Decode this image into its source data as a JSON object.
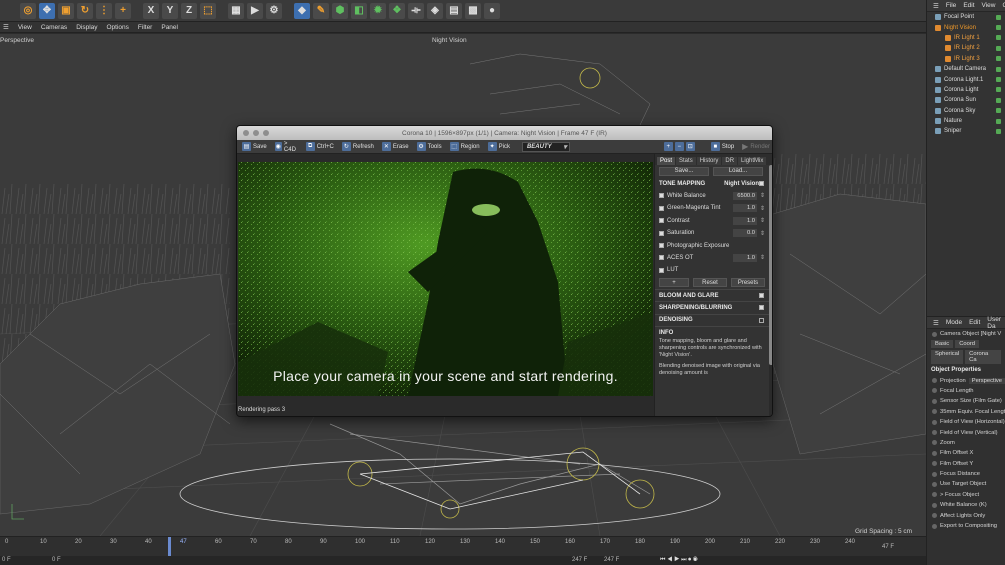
{
  "top_menu": [
    "View",
    "Cameras",
    "Display",
    "Options",
    "Filter",
    "Panel"
  ],
  "toolbar_axes": [
    "X",
    "Y",
    "Z"
  ],
  "viewport": {
    "label": "Perspective",
    "camera_label": "Night Vision",
    "grid_spacing": "Grid Spacing : 5 cm",
    "frame": "47 F"
  },
  "timeline": {
    "ticks": [
      "0",
      "10",
      "20",
      "30",
      "40",
      "47",
      "60",
      "70",
      "80",
      "90",
      "100",
      "110",
      "120",
      "130",
      "140",
      "150",
      "160",
      "170",
      "180",
      "190",
      "200",
      "210",
      "220",
      "230",
      "240"
    ],
    "current_frame": "47",
    "start": "0 F",
    "start2": "0 F",
    "end": "247 F",
    "end2": "247 F"
  },
  "objects_panel": {
    "menu": [
      "File",
      "Edit",
      "View",
      "Ob"
    ],
    "items": [
      {
        "label": "Focal Point",
        "type": "normal"
      },
      {
        "label": "Night Vision",
        "type": "orange"
      },
      {
        "label": "IR Light 1",
        "type": "light"
      },
      {
        "label": "IR Light 2",
        "type": "light"
      },
      {
        "label": "IR Light 3",
        "type": "light"
      },
      {
        "label": "Default Camera",
        "type": "normal"
      },
      {
        "label": "Corona Light.1",
        "type": "normal"
      },
      {
        "label": "Corona Light",
        "type": "normal"
      },
      {
        "label": "Corona Sun",
        "type": "normal"
      },
      {
        "label": "Corona Sky",
        "type": "normal"
      },
      {
        "label": "Nature",
        "type": "normal"
      },
      {
        "label": "Sniper",
        "type": "normal"
      }
    ]
  },
  "attributes_panel": {
    "menu": [
      "Mode",
      "Edit",
      "User Da"
    ],
    "object_label": "Camera Object [Night V",
    "tabs": [
      "Basic",
      "Coord",
      "Spherical",
      "Corona Ca"
    ],
    "section": "Object Properties",
    "rows": [
      {
        "label": "Projection",
        "value": "Perspective"
      },
      {
        "label": "Focal Length",
        "value": ""
      },
      {
        "label": "Sensor Size (Film Gate)",
        "value": ""
      },
      {
        "label": "35mm Equiv. Focal Length",
        "value": ""
      },
      {
        "label": "Field of View (Horizontal)",
        "value": ""
      },
      {
        "label": "Field of View (Vertical)",
        "value": ""
      },
      {
        "label": "Zoom",
        "value": ""
      },
      {
        "label": "Film Offset X",
        "value": ""
      },
      {
        "label": "Film Offset Y",
        "value": ""
      },
      {
        "label": "Focus Distance",
        "value": ""
      },
      {
        "label": "Use Target Object",
        "value": ""
      },
      {
        "label": "> Focus Object",
        "value": ""
      },
      {
        "label": "White Balance (K)",
        "value": ""
      },
      {
        "label": "Affect Lights Only",
        "value": ""
      },
      {
        "label": "Export to Compositing",
        "value": ""
      }
    ]
  },
  "corona": {
    "title": "Corona 10 | 1596×897px (1/1) | Camera: Night Vision | Frame 47 F (IR)",
    "toolbar": [
      "Save",
      "> C4D",
      "Ctrl+C",
      "Refresh",
      "Erase",
      "Tools",
      "Region",
      "Pick"
    ],
    "beauty": "BEAUTY",
    "stop": "Stop",
    "render": "Render",
    "caption": "Place your camera in your scene and start rendering.",
    "status": "Rendering pass 3",
    "tabs": [
      "Post",
      "Stats",
      "History",
      "DR",
      "LightMix"
    ],
    "save_btn": "Save...",
    "load_btn": "Load...",
    "tone_mapping": "TONE MAPPING",
    "tone_preset": "Night Vision",
    "params": [
      {
        "label": "White Balance",
        "value": "6500.0"
      },
      {
        "label": "Green-Magenta Tint",
        "value": "1.0"
      },
      {
        "label": "Contrast",
        "value": "1.0"
      },
      {
        "label": "Saturation",
        "value": "0.0"
      },
      {
        "label": "Photographic Exposure",
        "value": ""
      },
      {
        "label": "ACES OT",
        "value": "1.0"
      },
      {
        "label": "LUT",
        "value": ""
      }
    ],
    "plus": "+",
    "reset": "Reset",
    "presets": "Presets",
    "bloom": "BLOOM AND GLARE",
    "sharpening": "SHARPENING/BLURRING",
    "denoising": "DENOISING",
    "info_head": "INFO",
    "info1": "Tone mapping, bloom and glare and sharpening controls are synchronized with 'Night Vision'.",
    "info2": "Blending denoised image with original via denoising amount is"
  },
  "colors": {
    "accent_orange": "#f09a2a",
    "render_green": "#4a8a20"
  }
}
